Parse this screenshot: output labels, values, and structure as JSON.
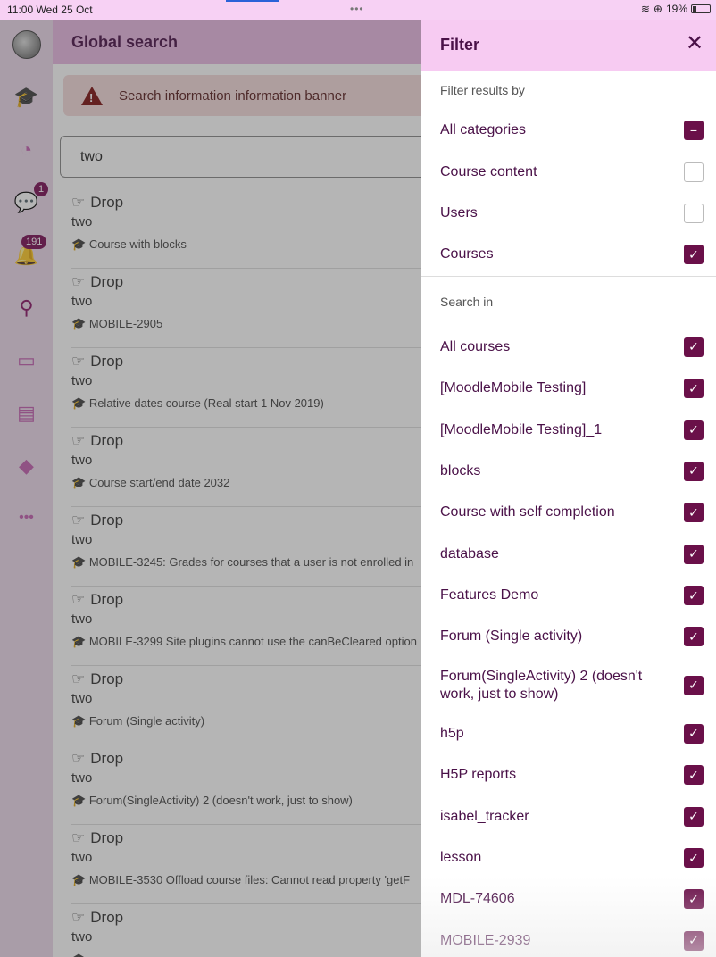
{
  "status": {
    "time": "11:00",
    "date": "Wed 25 Oct",
    "battery": "19%",
    "dots": "•••"
  },
  "rail": {
    "badge_messages": "1",
    "badge_notifications": "191"
  },
  "header": {
    "title": "Global search"
  },
  "banner": {
    "text": "Search information information banner"
  },
  "search": {
    "value": "two"
  },
  "results": [
    {
      "title": "Drop",
      "sub": "two",
      "course": "Course with blocks"
    },
    {
      "title": "Drop",
      "sub": "two",
      "course": "MOBILE-2905"
    },
    {
      "title": "Drop",
      "sub": "two",
      "course": "Relative dates course (Real start 1 Nov 2019)"
    },
    {
      "title": "Drop",
      "sub": "two",
      "course": "Course start/end date 2032"
    },
    {
      "title": "Drop",
      "sub": "two",
      "course": "MOBILE-3245: Grades for courses that a user is not enrolled in"
    },
    {
      "title": "Drop",
      "sub": "two",
      "course": "MOBILE-3299 Site plugins cannot use the canBeCleared option"
    },
    {
      "title": "Drop",
      "sub": "two",
      "course": "Forum (Single activity)"
    },
    {
      "title": "Drop",
      "sub": "two",
      "course": "Forum(SingleActivity) 2 (doesn't work, just to show)"
    },
    {
      "title": "Drop",
      "sub": "two",
      "course": "MOBILE-3530 Offload course files: Cannot read property 'getF"
    },
    {
      "title": "Drop",
      "sub": "two",
      "course": ""
    }
  ],
  "filter": {
    "title": "Filter",
    "close": "✕",
    "results_by_label": "Filter results by",
    "results_by": [
      {
        "label": "All categories",
        "state": "indeterminate"
      },
      {
        "label": "Course content",
        "state": "off"
      },
      {
        "label": "Users",
        "state": "off"
      },
      {
        "label": "Courses",
        "state": "on"
      }
    ],
    "search_in_label": "Search in",
    "search_in": [
      {
        "label": "All courses",
        "state": "on"
      },
      {
        "label": "[MoodleMobile Testing]",
        "state": "on"
      },
      {
        "label": "[MoodleMobile Testing]_1",
        "state": "on"
      },
      {
        "label": "blocks",
        "state": "on"
      },
      {
        "label": "Course with self completion",
        "state": "on"
      },
      {
        "label": "database",
        "state": "on"
      },
      {
        "label": "Features Demo",
        "state": "on"
      },
      {
        "label": "Forum (Single activity)",
        "state": "on"
      },
      {
        "label": "Forum(SingleActivity) 2 (doesn't work, just to show)",
        "state": "on",
        "tall": true
      },
      {
        "label": "h5p",
        "state": "on"
      },
      {
        "label": "H5P reports",
        "state": "on"
      },
      {
        "label": "isabel_tracker",
        "state": "on"
      },
      {
        "label": "lesson",
        "state": "on"
      },
      {
        "label": "MDL-74606",
        "state": "on"
      },
      {
        "label": "MOBILE-2939",
        "state": "on"
      }
    ]
  },
  "colors": {
    "accent": "#6a1049",
    "header": "#e8b9e2",
    "panel_header": "#f7cbf2"
  }
}
